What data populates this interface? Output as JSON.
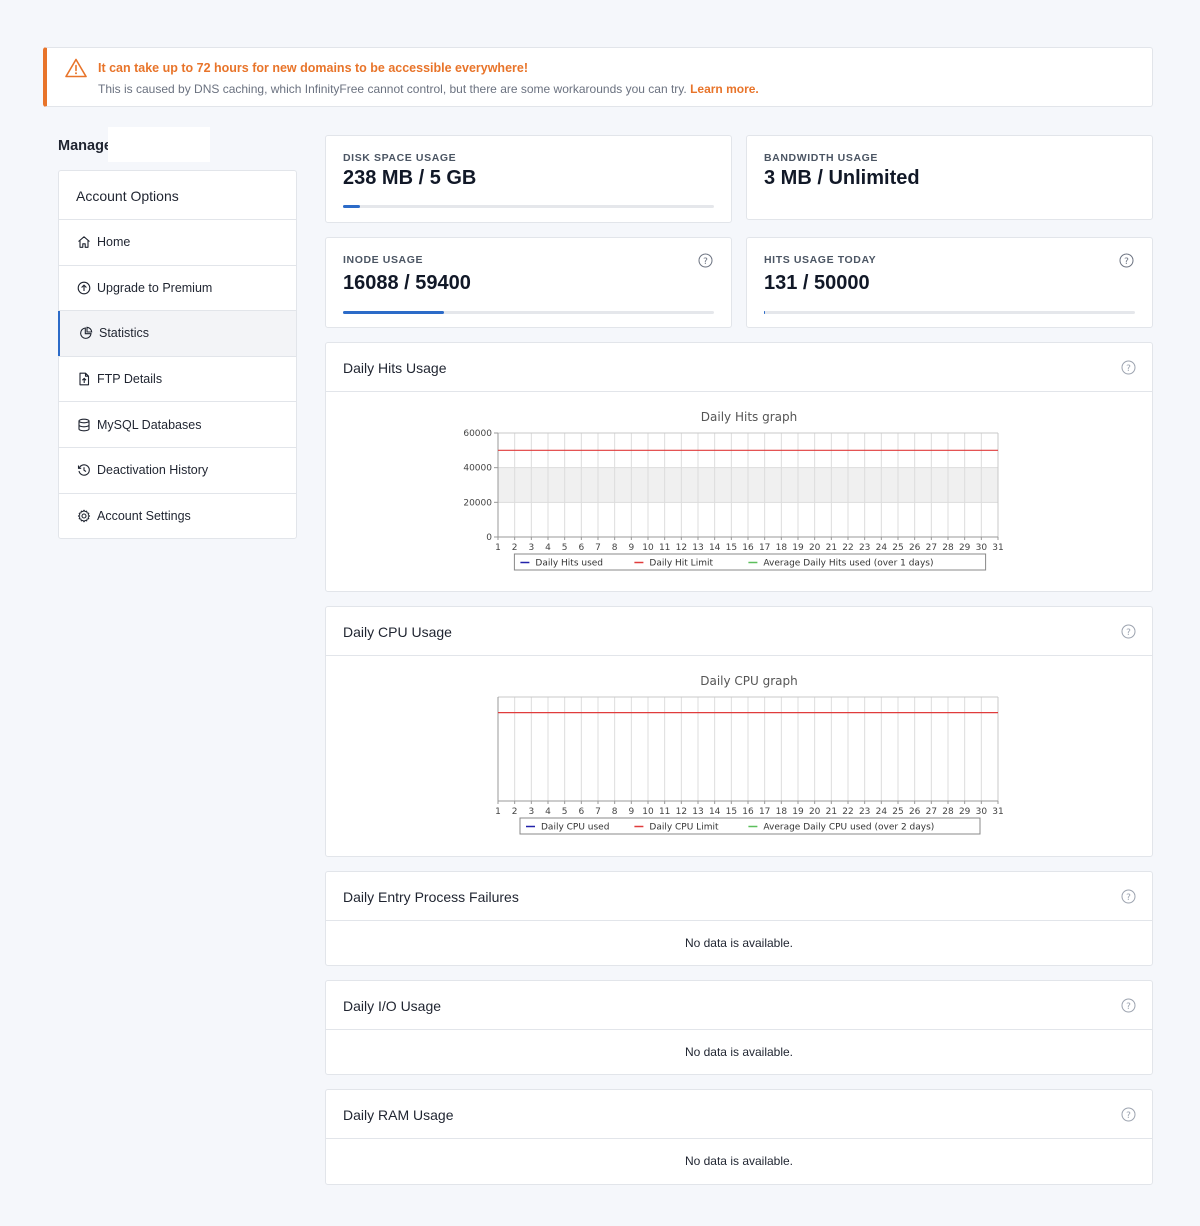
{
  "alert": {
    "title": "It can take up to 72 hours for new domains to be accessible everywhere!",
    "text": "This is caused by DNS caching, which InfinityFree cannot control, but there are some workarounds you can try.",
    "link": "Learn more."
  },
  "manage_title": "Manage",
  "sidebar": {
    "heading": "Account Options",
    "items": [
      {
        "label": "Home",
        "icon": "home-icon"
      },
      {
        "label": "Upgrade to Premium",
        "icon": "arrow-up-circle-icon"
      },
      {
        "label": "Statistics",
        "icon": "pie-chart-icon",
        "active": true
      },
      {
        "label": "FTP Details",
        "icon": "file-upload-icon"
      },
      {
        "label": "MySQL Databases",
        "icon": "database-icon"
      },
      {
        "label": "Deactivation History",
        "icon": "history-icon"
      },
      {
        "label": "Account Settings",
        "icon": "gear-icon"
      }
    ]
  },
  "stats": {
    "disk": {
      "label": "DISK SPACE USAGE",
      "value": "238 MB / 5 GB",
      "fraction": 0.047
    },
    "bandwidth": {
      "label": "BANDWIDTH USAGE",
      "value": "3 MB / Unlimited"
    },
    "inode": {
      "label": "INODE USAGE",
      "value": "16088 / 59400",
      "fraction": 0.271
    },
    "hits": {
      "label": "HITS USAGE TODAY",
      "value": "131 / 50000",
      "fraction": 0.003
    }
  },
  "panels": {
    "hits": {
      "title": "Daily Hits Usage"
    },
    "cpu": {
      "title": "Daily CPU Usage"
    },
    "entry": {
      "title": "Daily Entry Process Failures",
      "empty": "No data is available."
    },
    "io": {
      "title": "Daily I/O Usage",
      "empty": "No data is available."
    },
    "ram": {
      "title": "Daily RAM Usage",
      "empty": "No data is available."
    }
  },
  "colors": {
    "accent": "#e8742a",
    "primary": "#2c6bc8",
    "limit": "#e03c3c",
    "used": "#2222aa",
    "average": "#5cbf5c"
  },
  "chart_data": [
    {
      "type": "line",
      "title": "Daily Hits graph",
      "x": [
        "1",
        "2",
        "3",
        "4",
        "5",
        "6",
        "7",
        "8",
        "9",
        "10",
        "11",
        "12",
        "13",
        "14",
        "15",
        "16",
        "17",
        "18",
        "19",
        "20",
        "21",
        "22",
        "23",
        "24",
        "25",
        "26",
        "27",
        "28",
        "29",
        "30",
        "31"
      ],
      "yticks": [
        "0",
        "20000",
        "40000",
        "60000"
      ],
      "ylim": [
        0,
        60000
      ],
      "bands": [
        [
          20000,
          40000
        ]
      ],
      "series": [
        {
          "name": "Daily Hits used",
          "color": "#2222aa",
          "values": []
        },
        {
          "name": "Daily Hit Limit",
          "color": "#e03c3c",
          "constant": 50000
        },
        {
          "name": "Average Daily Hits used (over 1 days)",
          "color": "#5cbf5c",
          "values": []
        }
      ],
      "grid": true,
      "legend": "bottom"
    },
    {
      "type": "line",
      "title": "Daily CPU graph",
      "x": [
        "1",
        "2",
        "3",
        "4",
        "5",
        "6",
        "7",
        "8",
        "9",
        "10",
        "11",
        "12",
        "13",
        "14",
        "15",
        "16",
        "17",
        "18",
        "19",
        "20",
        "21",
        "22",
        "23",
        "24",
        "25",
        "26",
        "27",
        "28",
        "29",
        "30",
        "31"
      ],
      "yticks": [],
      "series": [
        {
          "name": "Daily CPU used",
          "color": "#2222aa",
          "values": []
        },
        {
          "name": "Daily CPU Limit",
          "color": "#e03c3c",
          "constant_level": 0.85
        },
        {
          "name": "Average Daily CPU used (over 2 days)",
          "color": "#5cbf5c",
          "values": []
        }
      ],
      "grid": true,
      "legend": "bottom"
    }
  ]
}
